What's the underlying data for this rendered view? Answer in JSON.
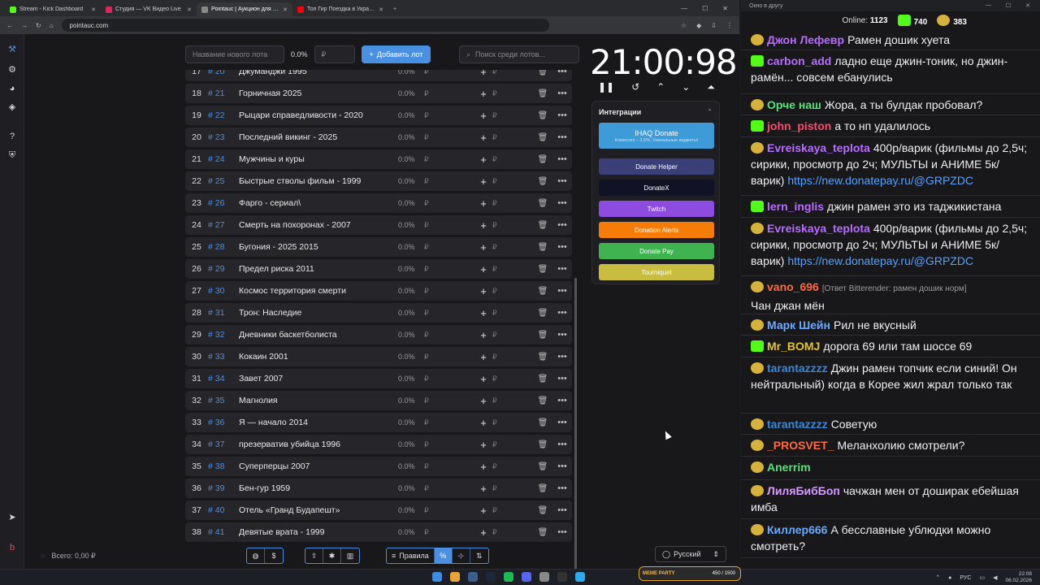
{
  "browser": {
    "tabs": [
      {
        "title": "Stream - Kick Dashboard",
        "color": "#53fc18"
      },
      {
        "title": "Студия — VK Видео Live",
        "color": "#e0245e"
      },
      {
        "title": "Pointauc | Аукцион для стримов",
        "color": "#888888"
      },
      {
        "title": "Топ Гир Поездка в Украину (...",
        "color": "#ff0000"
      }
    ],
    "url": "pointauc.com"
  },
  "auction": {
    "name_placeholder": "Название нового лота",
    "percent": "0.0%",
    "currency": "₽",
    "add_label": "Добавить лот",
    "search_placeholder": "Поиск среди лотов...",
    "lots": [
      {
        "n": "17",
        "id": "# 20",
        "name": "Джуманджи 1995"
      },
      {
        "n": "18",
        "id": "# 21",
        "name": "Горничная 2025"
      },
      {
        "n": "19",
        "id": "# 22",
        "name": "Рыцари справедливости - 2020"
      },
      {
        "n": "20",
        "id": "# 23",
        "name": "Последний викинг - 2025"
      },
      {
        "n": "21",
        "id": "# 24",
        "name": "Мужчины и куры"
      },
      {
        "n": "22",
        "id": "# 25",
        "name": "Быстрые стволы фильм - 1999"
      },
      {
        "n": "23",
        "id": "# 26",
        "name": "Фарго - сериал\\"
      },
      {
        "n": "24",
        "id": "# 27",
        "name": "Смерть на похоронах - 2007"
      },
      {
        "n": "25",
        "id": "# 28",
        "name": "Бугония - 2025 2015"
      },
      {
        "n": "26",
        "id": "# 29",
        "name": "Предел риска 2011"
      },
      {
        "n": "27",
        "id": "# 30",
        "name": "Космос территория смерти"
      },
      {
        "n": "28",
        "id": "# 31",
        "name": "Трон: Наследие"
      },
      {
        "n": "29",
        "id": "# 32",
        "name": "Дневники баскетболиста"
      },
      {
        "n": "30",
        "id": "# 33",
        "name": "Кокаин 2001"
      },
      {
        "n": "31",
        "id": "# 34",
        "name": "Завет 2007"
      },
      {
        "n": "32",
        "id": "# 35",
        "name": "Магнолия"
      },
      {
        "n": "33",
        "id": "# 36",
        "name": "Я — начало 2014"
      },
      {
        "n": "34",
        "id": "# 37",
        "name": "презерватив убийца 1996"
      },
      {
        "n": "35",
        "id": "# 38",
        "name": "Суперперцы 2007"
      },
      {
        "n": "36",
        "id": "# 39",
        "name": "Бен-гур 1959"
      },
      {
        "n": "37",
        "id": "# 40",
        "name": "Отель «Гранд Будапешт»"
      },
      {
        "n": "38",
        "id": "# 41",
        "name": "Девятые врата - 1999"
      }
    ],
    "lot_percent": "0.0%",
    "lot_currency": "₽",
    "total": "Всего: 0,00 ₽"
  },
  "timer": "21:00:98",
  "integrations": {
    "title": "Интеграции",
    "ihaq": {
      "label": "IHAQ Donate",
      "sub": "Комиссия – 3,5%. Уникальные виджеты!"
    },
    "buttons": [
      {
        "label": "Donate Helper",
        "color": "#3a3f78"
      },
      {
        "label": "DonateX",
        "color": "#121226"
      },
      {
        "label": "Twitch",
        "color": "#8d4be0"
      },
      {
        "label": "Donation Alerts",
        "color": "#f57d07"
      },
      {
        "label": "Donate Pay",
        "color": "#3fb34f"
      },
      {
        "label": "Tourniquet",
        "color": "#c9bd3f"
      }
    ]
  },
  "bottom": {
    "rules_label": "Правила",
    "percent_label": "%",
    "language": "Русский"
  },
  "chat": {
    "window_title": "Окно в другу",
    "online_label": "Online:",
    "online_count": "1123",
    "kick_count": "740",
    "gold_count": "383",
    "messages": [
      {
        "user": "Джон Лефевр",
        "color": "#b76cff",
        "text": "Рамен дошик хуета"
      },
      {
        "user": "carbon_add",
        "color": "#b76cff",
        "text": "ладно еще джин-тоник, но джин-рамён... совсем ебанулись"
      },
      {
        "user": "Орче наш",
        "color": "#59e27a",
        "text": "Жора, а ты булдак пробовал?"
      },
      {
        "user": "john_piston",
        "color": "#ff4b6a",
        "text": "а то нп удалилось"
      },
      {
        "user": "Evreiskaya_teplota",
        "color": "#b76cff",
        "text": "400р/варик (фильмы до 2,5ч; сирики, просмотр до 2ч; МУЛЬТЫ и АНИМЕ 5к/варик)",
        "link": "https://new.donatepay.ru/@GRPZDC"
      },
      {
        "user": "lern_inglis",
        "color": "#b76cff",
        "text": "джин рамен это из таджикистана"
      },
      {
        "user": "Evreiskaya_teplota",
        "color": "#b76cff",
        "text": "400р/варик (фильмы до 2,5ч; сирики, просмотр до 2ч; МУЛЬТЫ и АНИМЕ 5к/варик)",
        "link": "https://new.donatepay.ru/@GRPZDC"
      },
      {
        "user": "vano_696",
        "color": "#ff6b3d",
        "reply": "[Ответ Bitterender: рамен дошик норм]",
        "text": "Чан джан мён"
      },
      {
        "user": "Марк Шейн",
        "color": "#6aa9ff",
        "text": "Рил не вкусный"
      },
      {
        "user": "Mr_BOMJ",
        "color": "#e3c330",
        "text": "дорога 69 или там шоссе 69"
      },
      {
        "user": "tarantazzzz",
        "color": "#3b87d6",
        "text": "Джин рамен топчик если синий! Он нейтральный) когда в Корее жил жрал только так"
      },
      {
        "user": "tarantazzzz",
        "color": "#3b87d6",
        "text": "Советую"
      },
      {
        "user": "_PROSVET_",
        "color": "#ff6b3d",
        "text": "Меланхолию смотрели?"
      },
      {
        "user": "Anerrim",
        "color": "#59e27a",
        "text": ""
      },
      {
        "user": "ЛиляБибБоп",
        "color": "#d79bff",
        "text": "чачжан мен от доширак ебейшая имба"
      },
      {
        "user": "Киллер666",
        "color": "#6aa9ff",
        "text": "А бесславные ублюдки можно смотреть?"
      }
    ]
  },
  "taskbar": {
    "meme": "MEME PARTY",
    "meme_count": "450 / 1500",
    "lang": "РУС",
    "time": "22:08",
    "date": "06.02.2026"
  }
}
